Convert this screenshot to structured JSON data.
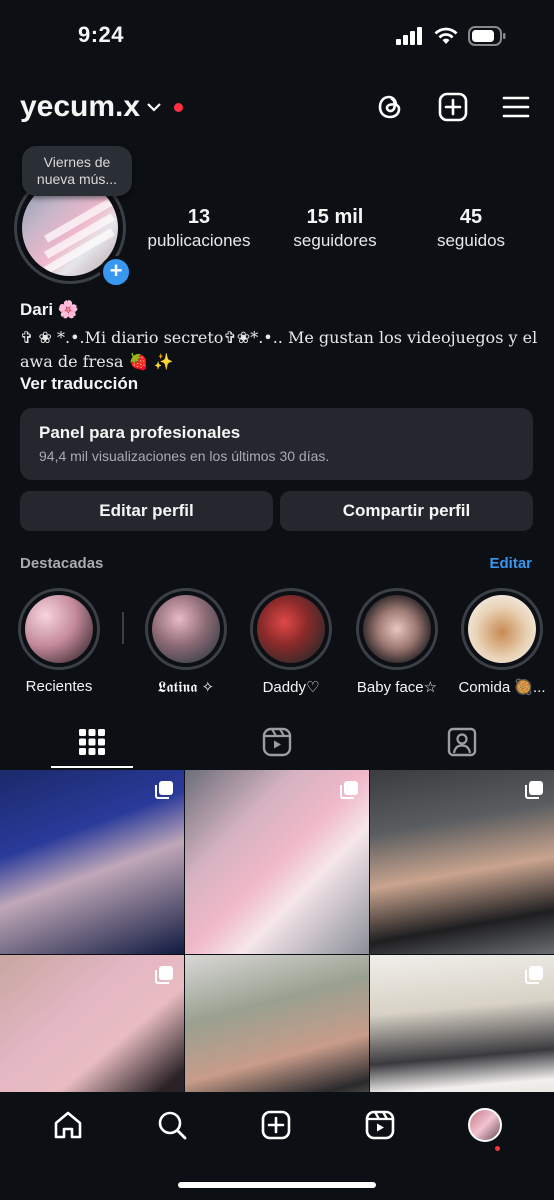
{
  "status_bar": {
    "time": "9:24"
  },
  "header": {
    "username": "yecum.x"
  },
  "profile": {
    "note": "Viernes de nueva mús...",
    "stats": [
      {
        "value": "13",
        "label": "publicaciones"
      },
      {
        "value": "15 mil",
        "label": "seguidores"
      },
      {
        "value": "45",
        "label": "seguidos"
      }
    ],
    "name": "Dari 🌸",
    "bio": "✞ ❀ *.•.Mi diario secreto✞❀*.•.. Me gustan los videojuegos y el awa de fresa 🍓 ✨",
    "see_translation": "Ver traducción"
  },
  "pro_panel": {
    "title": "Panel para profesionales",
    "subtitle": "94,4 mil visualizaciones en los últimos 30 días."
  },
  "actions": {
    "edit_profile": "Editar perfil",
    "share_profile": "Compartir perfil"
  },
  "highlights": {
    "label": "Destacadas",
    "edit": "Editar",
    "items": [
      {
        "label": "Recientes"
      },
      {
        "label": "𝕷𝖆𝖙𝖎𝖓𝖆 ✧"
      },
      {
        "label": "Daddy♡"
      },
      {
        "label": "Baby face☆"
      },
      {
        "label": "Comida 🥘..."
      }
    ]
  },
  "colors": {
    "accent": "#3897f0",
    "background": "#0c0f14",
    "surface": "#24272d",
    "notification": "#ff3040"
  }
}
